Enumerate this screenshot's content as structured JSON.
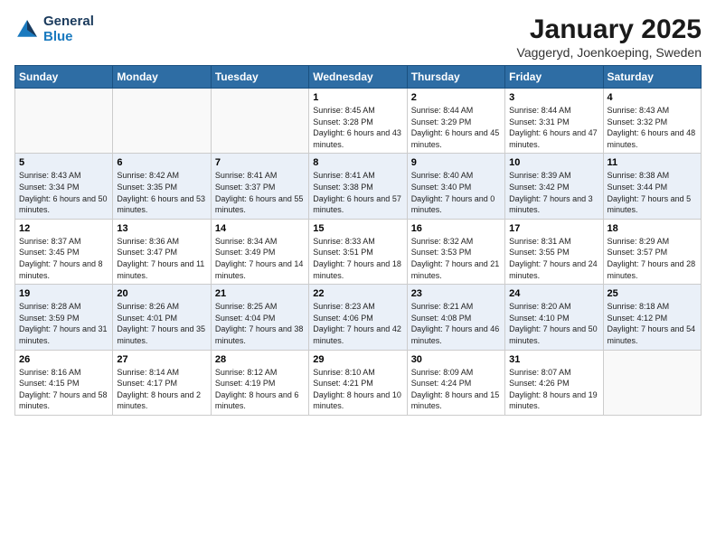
{
  "header": {
    "logo_general": "General",
    "logo_blue": "Blue",
    "title": "January 2025",
    "subtitle": "Vaggeryd, Joenkoeping, Sweden"
  },
  "weekdays": [
    "Sunday",
    "Monday",
    "Tuesday",
    "Wednesday",
    "Thursday",
    "Friday",
    "Saturday"
  ],
  "weeks": [
    {
      "days": [
        {
          "num": "",
          "info": ""
        },
        {
          "num": "",
          "info": ""
        },
        {
          "num": "",
          "info": ""
        },
        {
          "num": "1",
          "info": "Sunrise: 8:45 AM\nSunset: 3:28 PM\nDaylight: 6 hours and 43 minutes."
        },
        {
          "num": "2",
          "info": "Sunrise: 8:44 AM\nSunset: 3:29 PM\nDaylight: 6 hours and 45 minutes."
        },
        {
          "num": "3",
          "info": "Sunrise: 8:44 AM\nSunset: 3:31 PM\nDaylight: 6 hours and 47 minutes."
        },
        {
          "num": "4",
          "info": "Sunrise: 8:43 AM\nSunset: 3:32 PM\nDaylight: 6 hours and 48 minutes."
        }
      ]
    },
    {
      "days": [
        {
          "num": "5",
          "info": "Sunrise: 8:43 AM\nSunset: 3:34 PM\nDaylight: 6 hours and 50 minutes."
        },
        {
          "num": "6",
          "info": "Sunrise: 8:42 AM\nSunset: 3:35 PM\nDaylight: 6 hours and 53 minutes."
        },
        {
          "num": "7",
          "info": "Sunrise: 8:41 AM\nSunset: 3:37 PM\nDaylight: 6 hours and 55 minutes."
        },
        {
          "num": "8",
          "info": "Sunrise: 8:41 AM\nSunset: 3:38 PM\nDaylight: 6 hours and 57 minutes."
        },
        {
          "num": "9",
          "info": "Sunrise: 8:40 AM\nSunset: 3:40 PM\nDaylight: 7 hours and 0 minutes."
        },
        {
          "num": "10",
          "info": "Sunrise: 8:39 AM\nSunset: 3:42 PM\nDaylight: 7 hours and 3 minutes."
        },
        {
          "num": "11",
          "info": "Sunrise: 8:38 AM\nSunset: 3:44 PM\nDaylight: 7 hours and 5 minutes."
        }
      ]
    },
    {
      "days": [
        {
          "num": "12",
          "info": "Sunrise: 8:37 AM\nSunset: 3:45 PM\nDaylight: 7 hours and 8 minutes."
        },
        {
          "num": "13",
          "info": "Sunrise: 8:36 AM\nSunset: 3:47 PM\nDaylight: 7 hours and 11 minutes."
        },
        {
          "num": "14",
          "info": "Sunrise: 8:34 AM\nSunset: 3:49 PM\nDaylight: 7 hours and 14 minutes."
        },
        {
          "num": "15",
          "info": "Sunrise: 8:33 AM\nSunset: 3:51 PM\nDaylight: 7 hours and 18 minutes."
        },
        {
          "num": "16",
          "info": "Sunrise: 8:32 AM\nSunset: 3:53 PM\nDaylight: 7 hours and 21 minutes."
        },
        {
          "num": "17",
          "info": "Sunrise: 8:31 AM\nSunset: 3:55 PM\nDaylight: 7 hours and 24 minutes."
        },
        {
          "num": "18",
          "info": "Sunrise: 8:29 AM\nSunset: 3:57 PM\nDaylight: 7 hours and 28 minutes."
        }
      ]
    },
    {
      "days": [
        {
          "num": "19",
          "info": "Sunrise: 8:28 AM\nSunset: 3:59 PM\nDaylight: 7 hours and 31 minutes."
        },
        {
          "num": "20",
          "info": "Sunrise: 8:26 AM\nSunset: 4:01 PM\nDaylight: 7 hours and 35 minutes."
        },
        {
          "num": "21",
          "info": "Sunrise: 8:25 AM\nSunset: 4:04 PM\nDaylight: 7 hours and 38 minutes."
        },
        {
          "num": "22",
          "info": "Sunrise: 8:23 AM\nSunset: 4:06 PM\nDaylight: 7 hours and 42 minutes."
        },
        {
          "num": "23",
          "info": "Sunrise: 8:21 AM\nSunset: 4:08 PM\nDaylight: 7 hours and 46 minutes."
        },
        {
          "num": "24",
          "info": "Sunrise: 8:20 AM\nSunset: 4:10 PM\nDaylight: 7 hours and 50 minutes."
        },
        {
          "num": "25",
          "info": "Sunrise: 8:18 AM\nSunset: 4:12 PM\nDaylight: 7 hours and 54 minutes."
        }
      ]
    },
    {
      "days": [
        {
          "num": "26",
          "info": "Sunrise: 8:16 AM\nSunset: 4:15 PM\nDaylight: 7 hours and 58 minutes."
        },
        {
          "num": "27",
          "info": "Sunrise: 8:14 AM\nSunset: 4:17 PM\nDaylight: 8 hours and 2 minutes."
        },
        {
          "num": "28",
          "info": "Sunrise: 8:12 AM\nSunset: 4:19 PM\nDaylight: 8 hours and 6 minutes."
        },
        {
          "num": "29",
          "info": "Sunrise: 8:10 AM\nSunset: 4:21 PM\nDaylight: 8 hours and 10 minutes."
        },
        {
          "num": "30",
          "info": "Sunrise: 8:09 AM\nSunset: 4:24 PM\nDaylight: 8 hours and 15 minutes."
        },
        {
          "num": "31",
          "info": "Sunrise: 8:07 AM\nSunset: 4:26 PM\nDaylight: 8 hours and 19 minutes."
        },
        {
          "num": "",
          "info": ""
        }
      ]
    }
  ]
}
